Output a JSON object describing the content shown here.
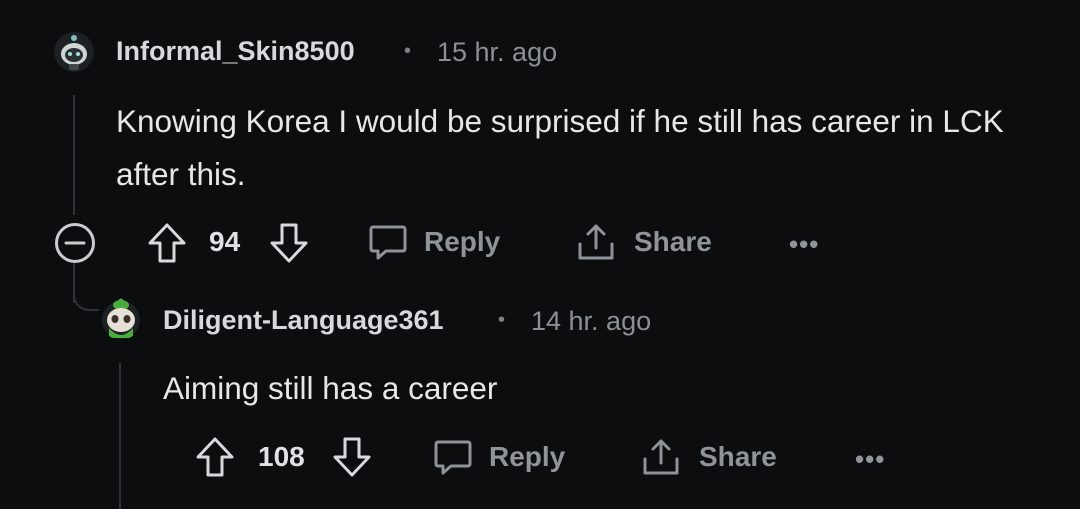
{
  "comment1": {
    "username": "Informal_Skin8500",
    "separator": "•",
    "time": "15 hr. ago",
    "body": "Knowing Korea I would be surprised if he still has career in LCK after this.",
    "votes": "94",
    "reply_label": "Reply",
    "share_label": "Share",
    "more_label": "•••",
    "avatar_icon": "snoo-avatar-icon"
  },
  "comment2": {
    "username": "Diligent-Language361",
    "separator": "•",
    "time": "14 hr. ago",
    "body": "Aiming still has a career",
    "votes": "108",
    "reply_label": "Reply",
    "share_label": "Share",
    "more_label": "•••",
    "avatar_icon": "green-snoo-avatar-icon"
  },
  "colors": {
    "background": "#0b0d0e",
    "text": "#d7dadc",
    "muted": "#8a9095",
    "thread_line": "#2f3336"
  }
}
